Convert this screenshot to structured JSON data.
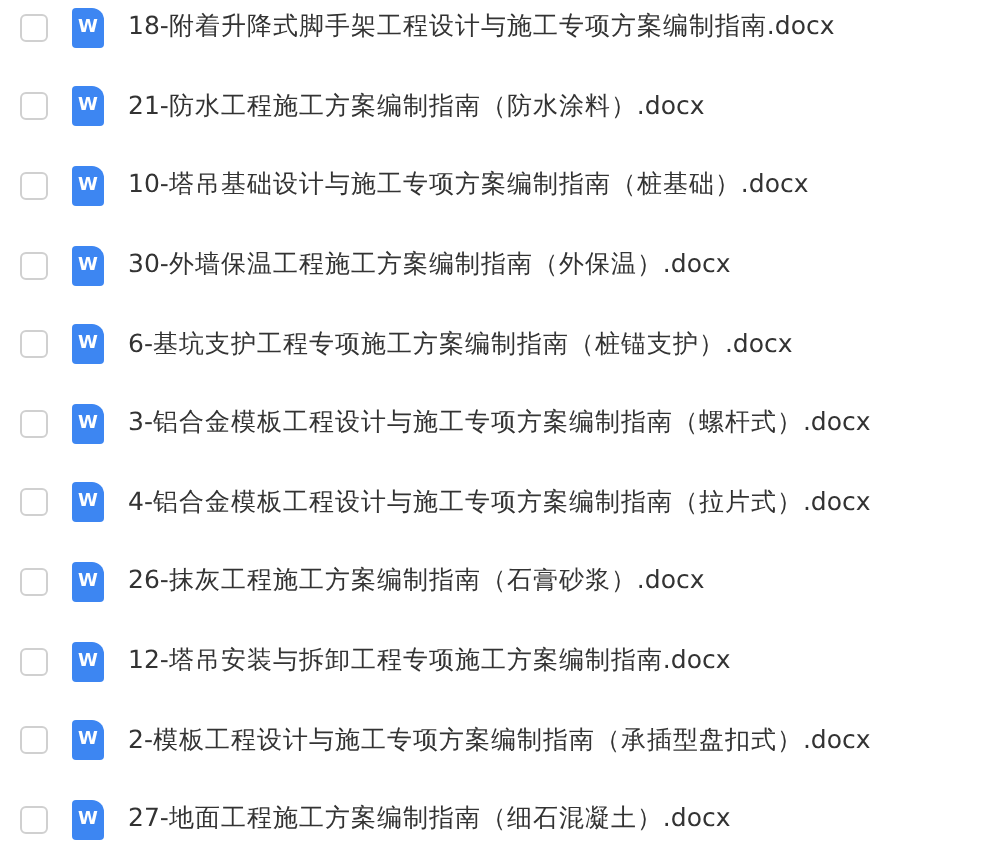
{
  "files": [
    {
      "name": "18-附着升降式脚手架工程设计与施工专项方案编制指南.docx",
      "icon_letter": "W",
      "checked": false
    },
    {
      "name": "21-防水工程施工方案编制指南（防水涂料）.docx",
      "icon_letter": "W",
      "checked": false
    },
    {
      "name": "10-塔吊基础设计与施工专项方案编制指南（桩基础）.docx",
      "icon_letter": "W",
      "checked": false
    },
    {
      "name": "30-外墙保温工程施工方案编制指南（外保温）.docx",
      "icon_letter": "W",
      "checked": false
    },
    {
      "name": "6-基坑支护工程专项施工方案编制指南（桩锚支护）.docx",
      "icon_letter": "W",
      "checked": false
    },
    {
      "name": "3-铝合金模板工程设计与施工专项方案编制指南（螺杆式）.docx",
      "icon_letter": "W",
      "checked": false
    },
    {
      "name": "4-铝合金模板工程设计与施工专项方案编制指南（拉片式）.docx",
      "icon_letter": "W",
      "checked": false
    },
    {
      "name": "26-抹灰工程施工方案编制指南（石膏砂浆）.docx",
      "icon_letter": "W",
      "checked": false
    },
    {
      "name": "12-塔吊安装与拆卸工程专项施工方案编制指南.docx",
      "icon_letter": "W",
      "checked": false
    },
    {
      "name": "2-模板工程设计与施工专项方案编制指南（承插型盘扣式）.docx",
      "icon_letter": "W",
      "checked": false
    },
    {
      "name": "27-地面工程施工方案编制指南（细石混凝土）.docx",
      "icon_letter": "W",
      "checked": false
    }
  ]
}
